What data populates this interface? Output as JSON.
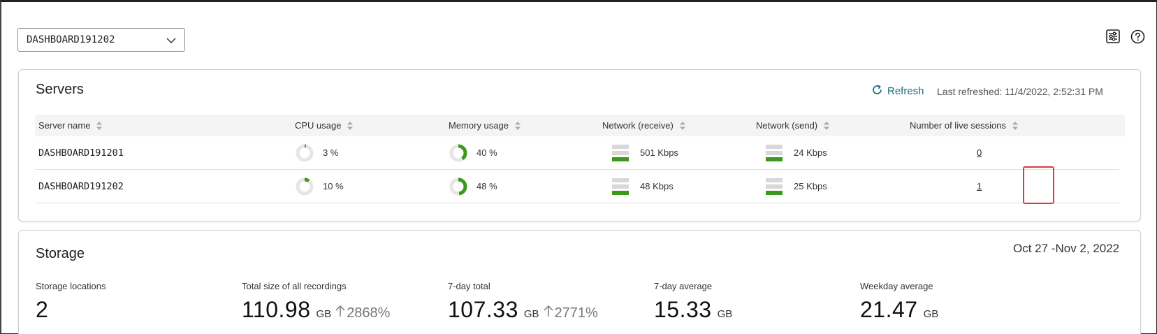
{
  "server_select": {
    "value": "DASHBOARD191202"
  },
  "toolbar": {
    "settings_icon": "sliders-icon",
    "help_icon": "help-circle-icon"
  },
  "servers": {
    "title": "Servers",
    "refresh_label": "Refresh",
    "last_refreshed": "Last refreshed: 11/4/2022, 2:52:31 PM",
    "columns": [
      "Server name",
      "CPU usage",
      "Memory usage",
      "Network (receive)",
      "Network (send)",
      "Number of live sessions"
    ],
    "rows": [
      {
        "name": "DASHBOARD191201",
        "cpu": "3 %",
        "cpu_pct": 3,
        "memory": "40 %",
        "memory_pct": 40,
        "net_receive": "501 Kbps",
        "net_send": "24 Kbps",
        "sessions": "0"
      },
      {
        "name": "DASHBOARD191202",
        "cpu": "10 %",
        "cpu_pct": 10,
        "memory": "48 %",
        "memory_pct": 48,
        "net_receive": "48 Kbps",
        "net_send": "25 Kbps",
        "sessions": "1"
      }
    ]
  },
  "storage": {
    "title": "Storage",
    "date_range": "Oct 27 -Nov 2, 2022",
    "metrics": [
      {
        "label": "Storage locations",
        "value": "2",
        "unit": "",
        "change": ""
      },
      {
        "label": "Total size of all recordings",
        "value": "110.98",
        "unit": "GB",
        "change": "2868%"
      },
      {
        "label": "7-day total",
        "value": "107.33",
        "unit": "GB",
        "change": "2771%"
      },
      {
        "label": "7-day average",
        "value": "15.33",
        "unit": "GB",
        "change": ""
      },
      {
        "label": "Weekday average",
        "value": "21.47",
        "unit": "GB",
        "change": ""
      }
    ]
  },
  "colors": {
    "accent": "#1a6a82",
    "usage_green": "#3a9a1a",
    "highlight_red": "#e03a3a"
  }
}
